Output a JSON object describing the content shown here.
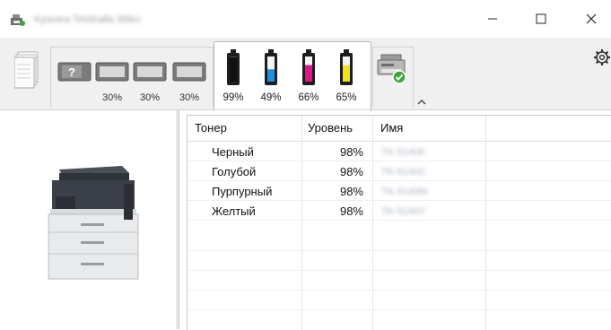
{
  "window": {
    "title": "Kyocera TASKalfa 356ci",
    "controls": {
      "minimize": "–",
      "maximize": "☐",
      "close": "✕"
    }
  },
  "toolbar": {
    "trays": [
      {
        "icon": "paper-tray-unknown-icon",
        "level": ""
      },
      {
        "icon": "paper-tray-icon",
        "level": "30%"
      },
      {
        "icon": "paper-tray-icon",
        "level": "30%"
      },
      {
        "icon": "paper-tray-icon",
        "level": "30%"
      }
    ],
    "toners": [
      {
        "color": "#111111",
        "level": "99%",
        "fill": 0.99
      },
      {
        "color": "#1c8fe0",
        "level": "49%",
        "fill": 0.49
      },
      {
        "color": "#e0158c",
        "level": "66%",
        "fill": 0.66
      },
      {
        "color": "#f2e219",
        "level": "65%",
        "fill": 0.65
      }
    ]
  },
  "table": {
    "headers": {
      "toner": "Тонер",
      "level": "Уровень",
      "name": "Имя"
    },
    "rows": [
      {
        "toner": "Черный",
        "level": "98%",
        "name": "TK-5140K"
      },
      {
        "toner": "Голубой",
        "level": "98%",
        "name": "TK-5140C"
      },
      {
        "toner": "Пурпурный",
        "level": "98%",
        "name": "TK-5140M"
      },
      {
        "toner": "Желтый",
        "level": "98%",
        "name": "TK-5140Y"
      }
    ]
  }
}
